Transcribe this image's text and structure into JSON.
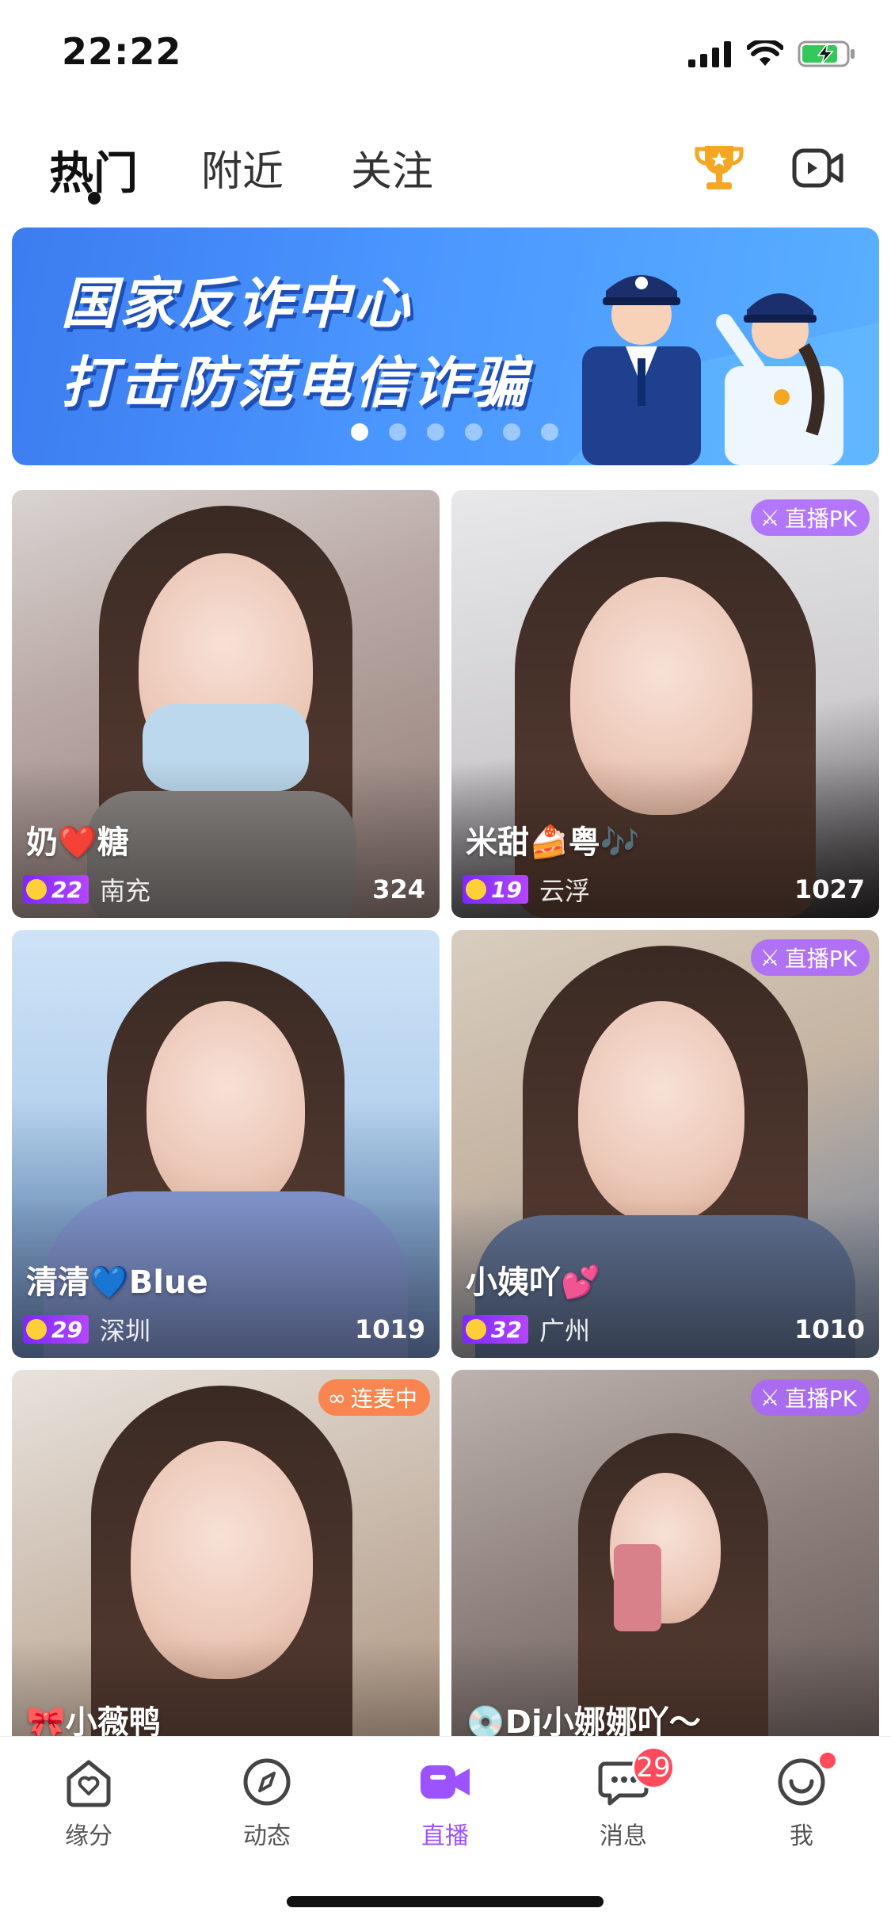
{
  "status_bar": {
    "time": "22:22"
  },
  "tabs": [
    {
      "label": "热门",
      "active": true
    },
    {
      "label": "附近",
      "active": false
    },
    {
      "label": "关注",
      "active": false
    }
  ],
  "top_icons": {
    "trophy": "trophy-icon",
    "video": "video-camera-icon"
  },
  "banner": {
    "line1": "国家反诈中心",
    "line2": "打击防范电信诈骗",
    "dots": 6,
    "active_dot": 0
  },
  "rooms": [
    {
      "name": "奶❤️糖",
      "level": "22",
      "city": "南充",
      "viewers": "324",
      "badge": ""
    },
    {
      "name": "米甜🍰粤🎶",
      "level": "19",
      "city": "云浮",
      "viewers": "1027",
      "badge": "直播PK"
    },
    {
      "name": "清清💙Blue",
      "level": "29",
      "city": "深圳",
      "viewers": "1019",
      "badge": ""
    },
    {
      "name": "小姨吖💕",
      "level": "32",
      "city": "广州",
      "viewers": "1010",
      "badge": "直播PK"
    },
    {
      "name": "🎀小薇鸭",
      "level": "",
      "city": "",
      "viewers": "",
      "badge": "连麦中"
    },
    {
      "name": "💿Dj小娜娜吖～",
      "level": "",
      "city": "",
      "viewers": "",
      "badge": "直播PK"
    }
  ],
  "bottom_nav": [
    {
      "label": "缘分",
      "icon": "heart-home-icon",
      "active": false
    },
    {
      "label": "动态",
      "icon": "compass-icon",
      "active": false
    },
    {
      "label": "直播",
      "icon": "live-video-icon",
      "active": true
    },
    {
      "label": "消息",
      "icon": "chat-icon",
      "active": false,
      "badge": "29"
    },
    {
      "label": "我",
      "icon": "smile-icon",
      "active": false,
      "dot": true
    }
  ],
  "colors": {
    "accent": "#9d52ff",
    "badge_red": "#ff4b5c"
  }
}
